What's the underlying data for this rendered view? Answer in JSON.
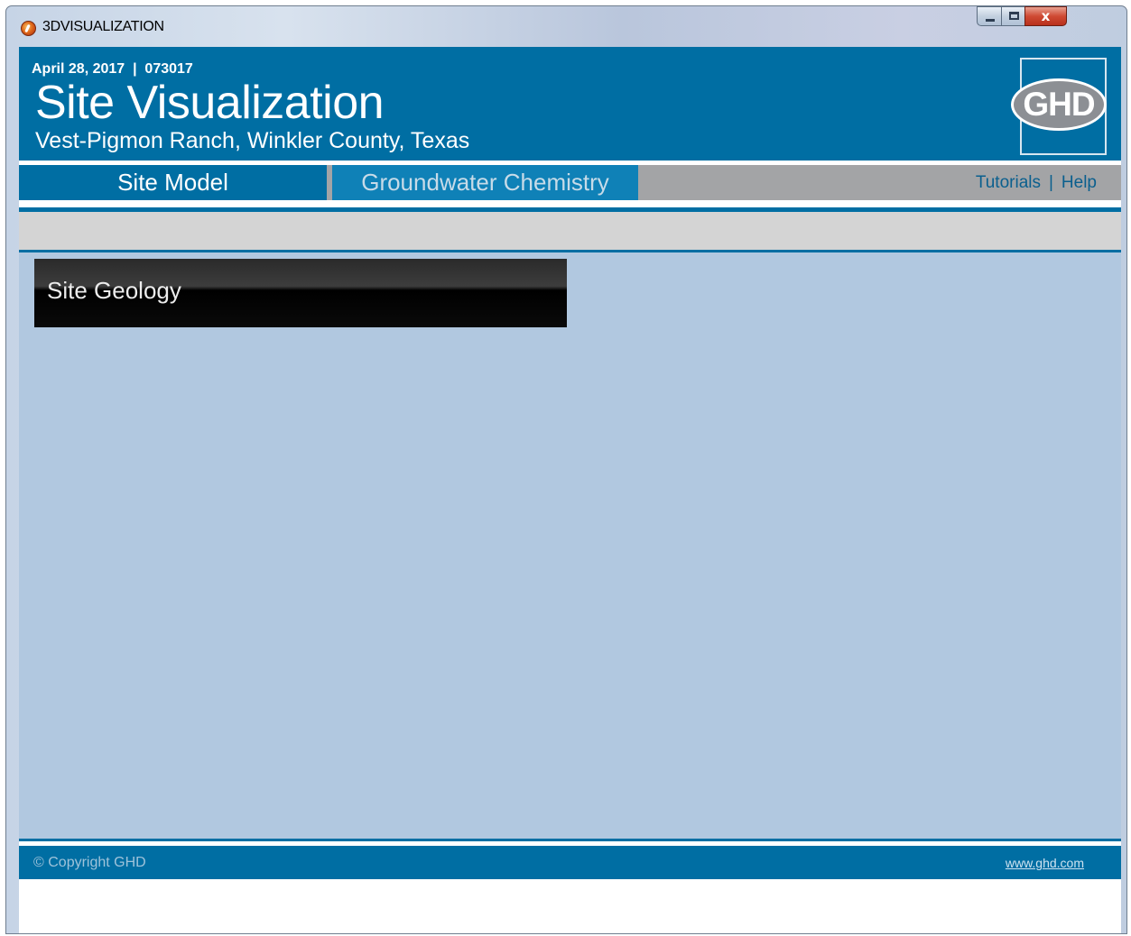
{
  "window": {
    "title": "3DVISUALIZATION",
    "controls": {
      "minimize": "minimize",
      "maximize": "maximize",
      "close": "x"
    }
  },
  "header": {
    "date_line": "April 28, 2017  |  073017",
    "title": "Site Visualization",
    "subtitle": "Vest-Pigmon Ranch, Winkler County, Texas",
    "logo_text": "GHD"
  },
  "tabs": [
    {
      "label": "Site Model",
      "active": true
    },
    {
      "label": "Groundwater Chemistry",
      "active": false
    }
  ],
  "links": {
    "tutorials": "Tutorials",
    "separator": "|",
    "help": "Help"
  },
  "panel": {
    "title": "Site Geology"
  },
  "footer": {
    "copyright": "© Copyright GHD",
    "site_link": "www.ghd.com"
  },
  "colors": {
    "brand_blue": "#006ea3",
    "content_bg": "#b1c8e0",
    "inactive_tab": "#0f81b7",
    "toolbar_gray": "#d4d4d4"
  }
}
